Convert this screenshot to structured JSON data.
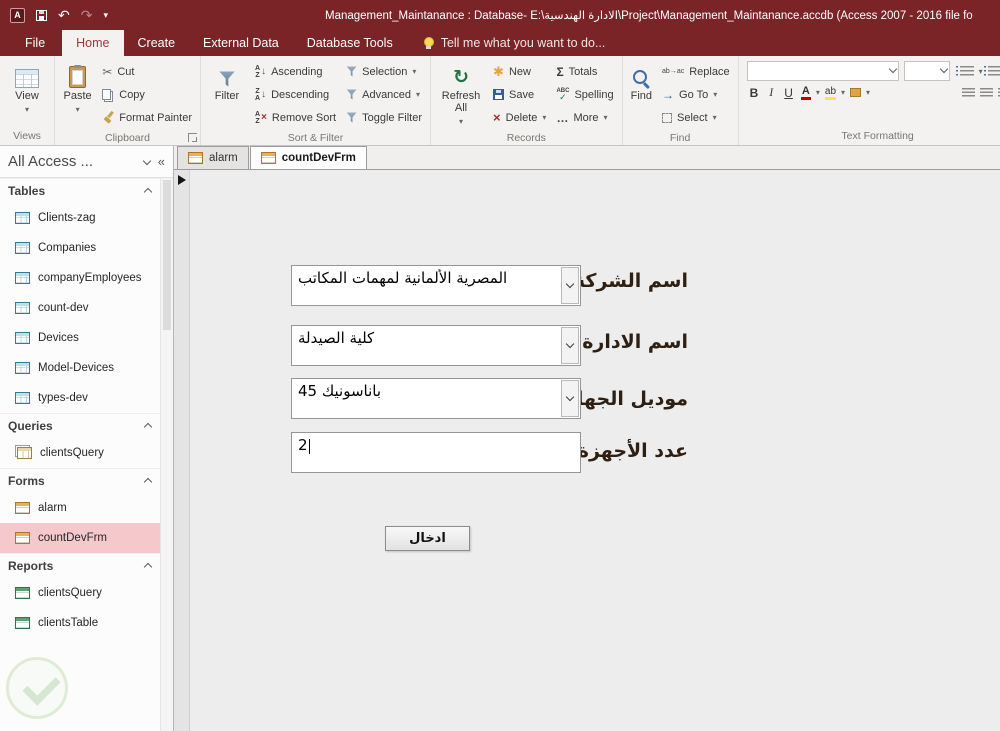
{
  "title_bar": {
    "title": "Management_Maintanance : Database- E:\\الادارة الهندسية\\Project\\Management_Maintanance.accdb (Access 2007 - 2016 file fo"
  },
  "ribbon": {
    "tabs": [
      {
        "label": "File",
        "active": false
      },
      {
        "label": "Home",
        "active": true
      },
      {
        "label": "Create",
        "active": false
      },
      {
        "label": "External Data",
        "active": false
      },
      {
        "label": "Database Tools",
        "active": false
      }
    ],
    "tell_me": "Tell me what you want to do...",
    "views": {
      "label": "Views",
      "view": "View"
    },
    "clipboard": {
      "label": "Clipboard",
      "paste": "Paste",
      "cut": "Cut",
      "copy": "Copy",
      "format_painter": "Format Painter"
    },
    "sort_filter": {
      "label": "Sort & Filter",
      "filter": "Filter",
      "ascending": "Ascending",
      "descending": "Descending",
      "remove_sort": "Remove Sort",
      "selection": "Selection",
      "advanced": "Advanced",
      "toggle_filter": "Toggle Filter"
    },
    "records": {
      "label": "Records",
      "refresh_all": "Refresh All",
      "new": "New",
      "save": "Save",
      "delete": "Delete",
      "totals": "Totals",
      "spelling": "Spelling",
      "more": "More"
    },
    "find": {
      "label": "Find",
      "find": "Find",
      "replace": "Replace",
      "go_to": "Go To",
      "select": "Select"
    },
    "text_formatting": {
      "label": "Text Formatting"
    }
  },
  "icons": {
    "title_bar": [
      "access-app-icon",
      "save-icon",
      "undo-icon",
      "redo-icon",
      "customize-quick-access-icon"
    ],
    "tell_me": "lightbulb-icon",
    "view": "datasheet-view-icon",
    "paste": "clipboard-icon",
    "cut": "scissors-icon",
    "copy": "copy-pages-icon",
    "format_painter": "paintbrush-icon",
    "filter": "funnel-icon",
    "refresh_all": "refresh-icon",
    "new": "new-record-star-icon",
    "save": "floppy-disk-icon",
    "delete": "red-x-icon",
    "totals": "sigma-icon",
    "spelling": "abc-check-icon",
    "find": "magnifier-icon",
    "nav_table": "table-grid-icon",
    "nav_query": "query-tables-icon",
    "nav_form": "form-icon",
    "nav_report": "report-icon",
    "record_marker": "current-record-triangle-icon",
    "combo_arrow": "chevron-down-icon",
    "watermark": "circular-leaf-logo"
  },
  "nav": {
    "title": "All Access ...",
    "sections": [
      {
        "label": "Tables",
        "items": [
          {
            "label": "Clients-zag",
            "icon": "table-icon"
          },
          {
            "label": "Companies",
            "icon": "table-icon"
          },
          {
            "label": "companyEmployees",
            "icon": "table-icon"
          },
          {
            "label": "count-dev",
            "icon": "table-icon"
          },
          {
            "label": "Devices",
            "icon": "table-icon"
          },
          {
            "label": "Model-Devices",
            "icon": "table-icon"
          },
          {
            "label": "types-dev",
            "icon": "table-icon"
          }
        ]
      },
      {
        "label": "Queries",
        "items": [
          {
            "label": "clientsQuery",
            "icon": "query-icon"
          }
        ]
      },
      {
        "label": "Forms",
        "items": [
          {
            "label": "alarm",
            "icon": "form-icon"
          },
          {
            "label": "countDevFrm",
            "icon": "form-icon",
            "selected": true
          }
        ]
      },
      {
        "label": "Reports",
        "items": [
          {
            "label": "clientsQuery",
            "icon": "report-icon"
          },
          {
            "label": "clientsTable",
            "icon": "report-icon"
          }
        ]
      }
    ]
  },
  "doc_tabs": [
    {
      "label": "alarm",
      "active": false
    },
    {
      "label": "countDevFrm",
      "active": true
    }
  ],
  "form": {
    "fields": [
      {
        "label": "اسم الشركة",
        "value": "المصرية الألمانية لمهمات المكاتب",
        "type": "combo"
      },
      {
        "label": "اسم الادارة",
        "value": "كلية الصيدلة",
        "type": "combo"
      },
      {
        "label": "موديل الجهاز",
        "value": "باناسونيك 45",
        "type": "combo"
      },
      {
        "label": "عدد الأجهزة",
        "value": "2",
        "type": "text"
      }
    ],
    "submit": "ادخال"
  }
}
